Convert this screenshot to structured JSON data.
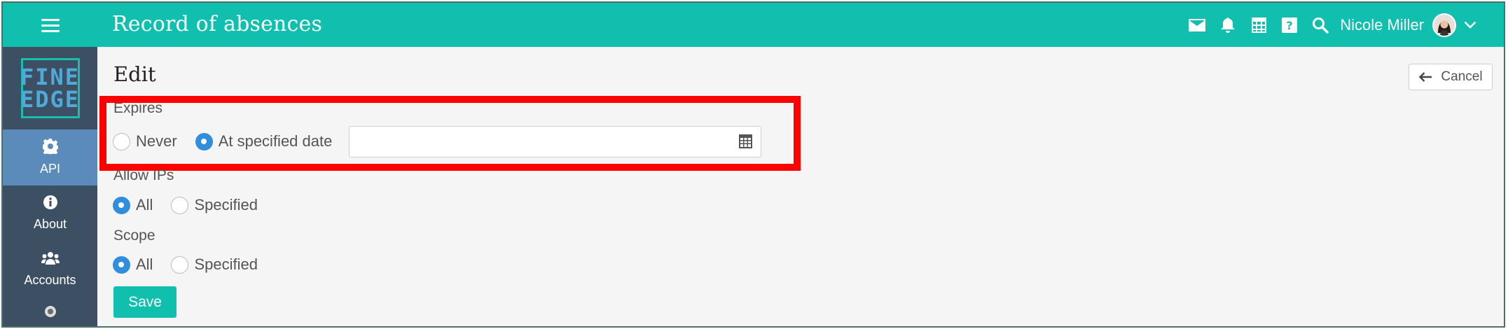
{
  "header": {
    "app_title": "Record of absences",
    "user_name": "Nicole Miller",
    "icons": [
      "menu-icon",
      "mail-icon",
      "bell-icon",
      "calendar-icon",
      "help-icon",
      "search-icon",
      "avatar",
      "chevron-down-icon"
    ]
  },
  "sidebar": {
    "logo": {
      "line1": "FINE",
      "line2": "EDGE"
    },
    "items": [
      {
        "label": "API",
        "icon": "gear-icon",
        "active": true
      },
      {
        "label": "About",
        "icon": "info-icon",
        "active": false
      },
      {
        "label": "Accounts",
        "icon": "users-icon",
        "active": false
      }
    ]
  },
  "main": {
    "title": "Edit",
    "cancel_label": "Cancel",
    "expires": {
      "label": "Expires",
      "options": [
        "Never",
        "At specified date"
      ],
      "selected": "At specified date",
      "date_value": ""
    },
    "allow_ips": {
      "label": "Allow IPs",
      "options": [
        "All",
        "Specified"
      ],
      "selected": "All"
    },
    "scope": {
      "label": "Scope",
      "options": [
        "All",
        "Specified"
      ],
      "selected": "All"
    },
    "save_label": "Save"
  },
  "colors": {
    "accent": "#11bfae",
    "sidebar": "#3d4f62",
    "sidebar_active": "#5a8bba",
    "radio_selected": "#2f8fdc",
    "highlight": "#ff0000"
  }
}
